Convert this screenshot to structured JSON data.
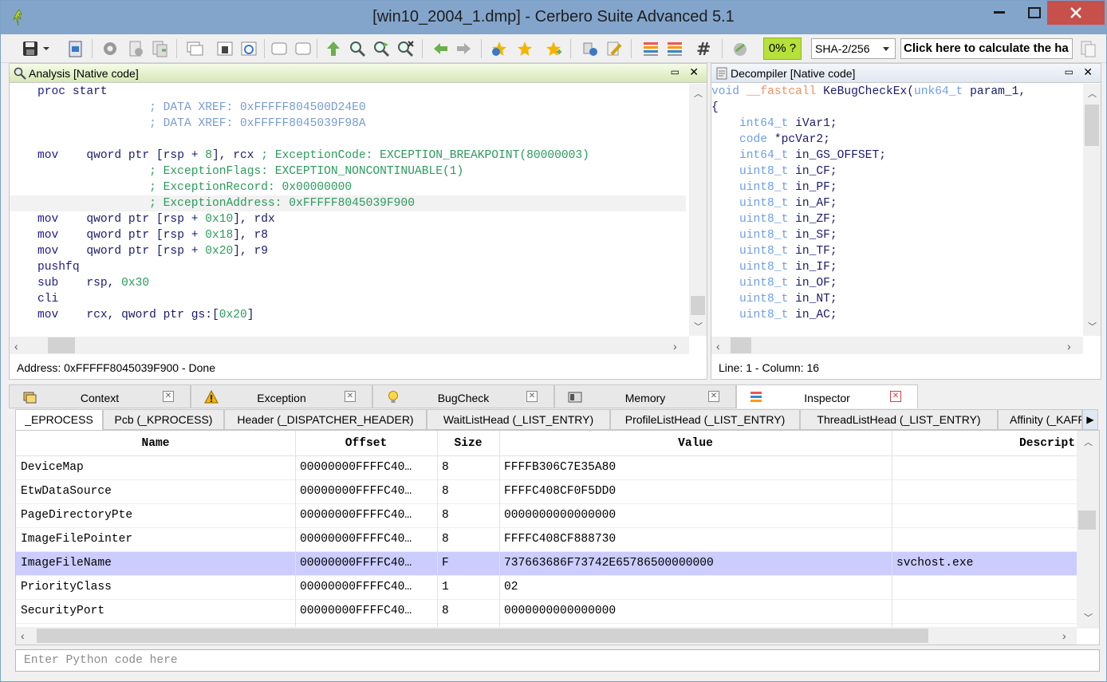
{
  "window": {
    "title": "[win10_2004_1.dmp] - Cerbero Suite Advanced 5.1"
  },
  "toolbar": {
    "progress": "0%",
    "progress_q": "?",
    "hash_algo": "SHA-2/256",
    "hash_prompt": "Click here to calculate the ha"
  },
  "analysis": {
    "title": "Analysis [Native code]",
    "status": "Address: 0xFFFFF8045039F900 - Done",
    "lines": [
      {
        "indent": "    ",
        "kw": "proc",
        "rest": " start",
        "type": "proc"
      },
      {
        "indent": "                    ",
        "comment": "; DATA XREF: 0xFFFFF804500D24E0",
        "type": "xref"
      },
      {
        "indent": "                    ",
        "comment": "; DATA XREF: 0xFFFFF8045039F98A",
        "type": "xref"
      },
      {
        "type": "blank"
      },
      {
        "indent": "    ",
        "kw": "mov",
        "pad": "    ",
        "op": "qword ptr [rsp + ",
        "num": "8",
        "op2": "], rcx",
        "comment": " ; ExceptionCode: EXCEPTION_BREAKPOINT(80000003)",
        "type": "instr"
      },
      {
        "indent": "                    ",
        "comment": "; ExceptionFlags: EXCEPTION_NONCONTINUABLE(1)",
        "type": "gcomment"
      },
      {
        "indent": "                    ",
        "comment": "; ExceptionRecord: 0x00000000",
        "type": "gcomment"
      },
      {
        "indent": "                    ",
        "comment": "; ExceptionAddress: 0xFFFFF8045039F900",
        "type": "gcomment",
        "hl": true
      },
      {
        "indent": "    ",
        "kw": "mov",
        "pad": "    ",
        "op": "qword ptr [rsp + ",
        "num": "0x10",
        "op2": "], rdx",
        "type": "instr"
      },
      {
        "indent": "    ",
        "kw": "mov",
        "pad": "    ",
        "op": "qword ptr [rsp + ",
        "num": "0x18",
        "op2": "], r8",
        "type": "instr"
      },
      {
        "indent": "    ",
        "kw": "mov",
        "pad": "    ",
        "op": "qword ptr [rsp + ",
        "num": "0x20",
        "op2": "], r9",
        "type": "instr"
      },
      {
        "indent": "    ",
        "kw": "pushfq",
        "type": "instr"
      },
      {
        "indent": "    ",
        "kw": "sub",
        "pad": "    ",
        "op": "rsp, ",
        "num": "0x30",
        "type": "instr"
      },
      {
        "indent": "    ",
        "kw": "cli",
        "type": "instr"
      },
      {
        "indent": "    ",
        "kw": "mov",
        "pad": "    ",
        "op": "rcx, qword ptr gs:[",
        "num": "0x20",
        "op2": "]",
        "type": "instr"
      }
    ]
  },
  "decompiler": {
    "title": "Decompiler [Native code]",
    "status": "Line: 1 - Column: 16",
    "signature": {
      "ret": "void",
      "call": "__fastcall",
      "name": "KeBugCheckEx",
      "open": "(",
      "ptype": "unk64_t",
      "pname": "param_1",
      "tail": ", "
    },
    "brace": "{",
    "decls": [
      {
        "type": "int64_t",
        "name": "iVar1;"
      },
      {
        "type": "code",
        "name": "*pcVar2;"
      },
      {
        "type": "int64_t",
        "name": "in_GS_OFFSET;"
      },
      {
        "type": "uint8_t",
        "name": "in_CF;"
      },
      {
        "type": "uint8_t",
        "name": "in_PF;"
      },
      {
        "type": "uint8_t",
        "name": "in_AF;"
      },
      {
        "type": "uint8_t",
        "name": "in_ZF;"
      },
      {
        "type": "uint8_t",
        "name": "in_SF;"
      },
      {
        "type": "uint8_t",
        "name": "in_TF;"
      },
      {
        "type": "uint8_t",
        "name": "in_IF;"
      },
      {
        "type": "uint8_t",
        "name": "in_OF;"
      },
      {
        "type": "uint8_t",
        "name": "in_NT;"
      },
      {
        "type": "uint8_t",
        "name": "in_AC;"
      }
    ]
  },
  "tabs": [
    {
      "label": "Context",
      "icon": "context-icon"
    },
    {
      "label": "Exception",
      "icon": "warning-icon"
    },
    {
      "label": "BugCheck",
      "icon": "lightbulb-icon"
    },
    {
      "label": "Memory",
      "icon": "memory-icon"
    },
    {
      "label": "Inspector",
      "icon": "inspector-icon",
      "active": true
    }
  ],
  "subtabs": [
    {
      "label": "_EPROCESS",
      "active": true
    },
    {
      "label": "Pcb (_KPROCESS)"
    },
    {
      "label": "Header (_DISPATCHER_HEADER)"
    },
    {
      "label": "WaitListHead (_LIST_ENTRY)"
    },
    {
      "label": "ProfileListHead (_LIST_ENTRY)"
    },
    {
      "label": "ThreadListHead (_LIST_ENTRY)"
    },
    {
      "label": "Affinity (_KAFFIN"
    }
  ],
  "grid": {
    "columns": [
      "Name",
      "Offset",
      "Size",
      "Value",
      "Descript"
    ],
    "rows": [
      {
        "name": "DeviceMap",
        "offset": "00000000FFFFC40…",
        "size": "8",
        "value": "FFFFB306C7E35A80",
        "desc": ""
      },
      {
        "name": "EtwDataSource",
        "offset": "00000000FFFFC40…",
        "size": "8",
        "value": "FFFFC408CF0F5DD0",
        "desc": ""
      },
      {
        "name": "PageDirectoryPte",
        "offset": "00000000FFFFC40…",
        "size": "8",
        "value": "0000000000000000",
        "desc": ""
      },
      {
        "name": "ImageFilePointer",
        "offset": "00000000FFFFC40…",
        "size": "8",
        "value": "FFFFC408CF888730",
        "desc": ""
      },
      {
        "name": "ImageFileName",
        "offset": "00000000FFFFC40…",
        "size": "F",
        "value": "737663686F73742E65786500000000",
        "desc": "svchost.exe",
        "selected": true
      },
      {
        "name": "PriorityClass",
        "offset": "00000000FFFFC40…",
        "size": "1",
        "value": "02",
        "desc": ""
      },
      {
        "name": "SecurityPort",
        "offset": "00000000FFFFC40…",
        "size": "8",
        "value": "0000000000000000",
        "desc": ""
      }
    ]
  },
  "python": {
    "placeholder": "Enter Python code here"
  }
}
